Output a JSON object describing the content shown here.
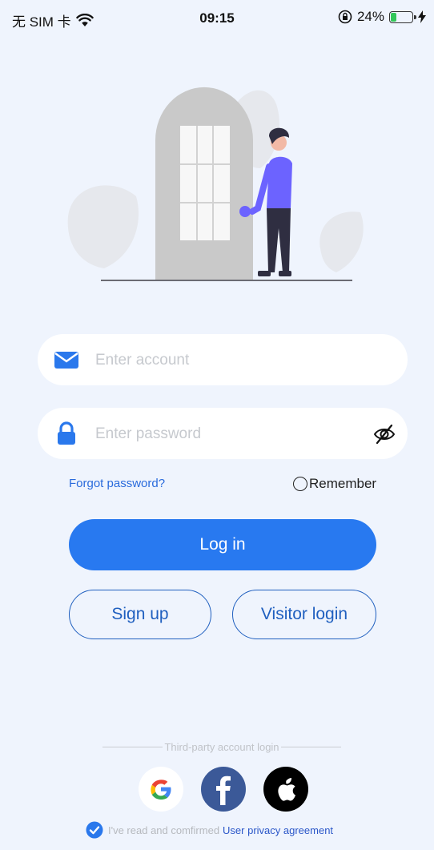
{
  "status_bar": {
    "carrier": "无 SIM 卡",
    "time": "09:15",
    "battery_percent": "24%",
    "battery_level": 0.24,
    "icons": [
      "wifi-icon",
      "orientation-lock-icon",
      "battery-icon",
      "charging-bolt-icon"
    ]
  },
  "login_form": {
    "account_placeholder": "Enter account",
    "password_placeholder": "Enter password",
    "account_icon": "mail-icon",
    "password_icon": "lock-icon",
    "toggle_icon": "eye-slash-icon",
    "forgot_label": "Forgot password?",
    "remember_label": "Remember",
    "remember_checked": false
  },
  "actions": {
    "login_label": "Log in",
    "signup_label": "Sign up",
    "visitor_label": "Visitor login"
  },
  "third_party": {
    "label": "Third-party account login",
    "providers": [
      "google",
      "facebook",
      "apple"
    ]
  },
  "agreement": {
    "text": "I've read and comfirmed",
    "link": "User privacy agreement",
    "checked": true
  },
  "colors": {
    "background": "#eff4fd",
    "primary": "#2879f0",
    "outline": "#1f5fbf",
    "link": "#2a56c8"
  }
}
